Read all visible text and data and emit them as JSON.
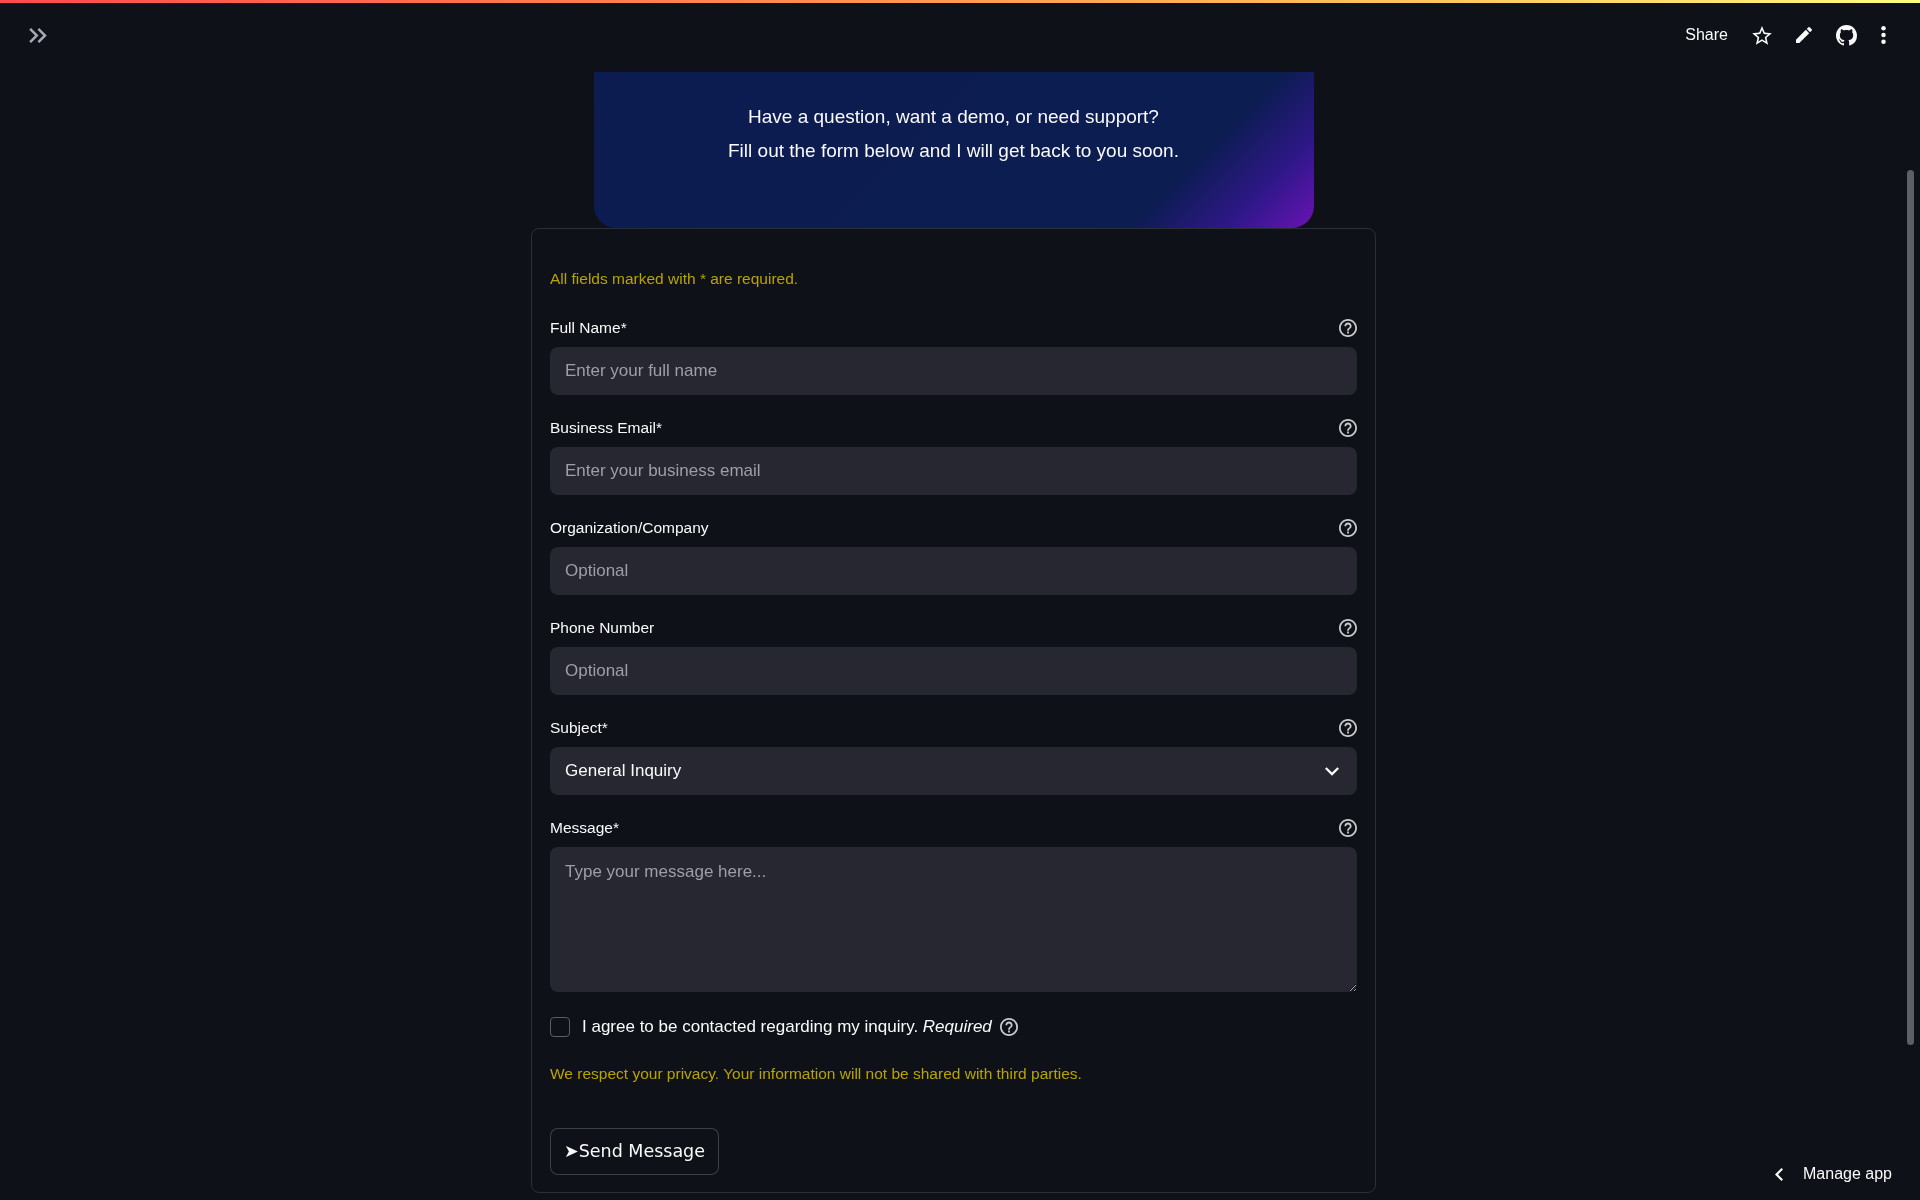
{
  "toolbar": {
    "share_label": "Share"
  },
  "banner": {
    "lines": [
      "Have a question, want a demo, or need support?",
      "Fill out the form below and I will get back to you soon."
    ]
  },
  "form": {
    "required_note": "All fields marked with * are required.",
    "fields": [
      {
        "kind": "text",
        "label": "Full Name*",
        "placeholder": "Enter your full name"
      },
      {
        "kind": "text",
        "label": "Business Email*",
        "placeholder": "Enter your business email"
      },
      {
        "kind": "text",
        "label": "Organization/Company",
        "placeholder": "Optional"
      },
      {
        "kind": "text",
        "label": "Phone Number",
        "placeholder": "Optional"
      },
      {
        "kind": "select",
        "label": "Subject*",
        "value": "General Inquiry"
      },
      {
        "kind": "textarea",
        "label": "Message*",
        "placeholder": "Type your message here..."
      }
    ],
    "consent": {
      "label": "I agree to be contacted regarding my inquiry. *Required*",
      "checked": false
    },
    "privacy_note": "We respect your privacy. Your information will not be shared with third parties.",
    "submit_label": "➤Send Message"
  },
  "manage_app": {
    "label": "Manage app"
  }
}
